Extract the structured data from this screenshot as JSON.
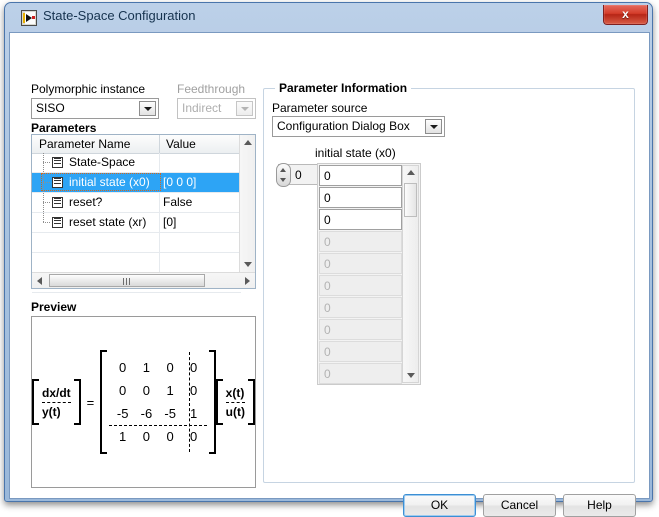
{
  "window": {
    "title": "State-Space Configuration",
    "icon": "labview-vi-icon",
    "close_label": "x"
  },
  "left_panel": {
    "polymorphic_label": "Polymorphic instance",
    "polymorphic_value": "SISO",
    "feedthrough_label": "Feedthrough",
    "feedthrough_value": "Indirect",
    "parameters_label": "Parameters",
    "table": {
      "columns": [
        "Parameter Name",
        "Value"
      ],
      "rows": [
        {
          "name": "State-Space",
          "value": "",
          "selected": false
        },
        {
          "name": "initial state (x0)",
          "value": "[0 0 0]",
          "selected": true
        },
        {
          "name": "reset?",
          "value": "False",
          "selected": false
        },
        {
          "name": "reset state (xr)",
          "value": "[0]",
          "selected": false
        }
      ]
    }
  },
  "preview": {
    "label": "Preview",
    "lhs_top": "dx/dt",
    "lhs_bottom": "y(t)",
    "equals": "=",
    "matrix": [
      [
        "0",
        "1",
        "0",
        "0"
      ],
      [
        "0",
        "0",
        "1",
        "0"
      ],
      [
        "-5",
        "-6",
        "-5",
        "1"
      ],
      [
        "1",
        "0",
        "0",
        "0"
      ]
    ],
    "rhs_top": "x(t)",
    "rhs_bottom": "u(t)"
  },
  "parameter_information": {
    "legend": "Parameter Information",
    "source_label": "Parameter source",
    "source_value": "Configuration Dialog Box",
    "array_label": "initial state (x0)",
    "array_index": "0",
    "array_cells": [
      {
        "value": "0",
        "active": true
      },
      {
        "value": "0",
        "active": true
      },
      {
        "value": "0",
        "active": true
      },
      {
        "value": "0",
        "active": false
      },
      {
        "value": "0",
        "active": false
      },
      {
        "value": "0",
        "active": false
      },
      {
        "value": "0",
        "active": false
      },
      {
        "value": "0",
        "active": false
      },
      {
        "value": "0",
        "active": false
      },
      {
        "value": "0",
        "active": false
      }
    ]
  },
  "buttons": {
    "ok": "OK",
    "cancel": "Cancel",
    "help": "Help"
  },
  "colors": {
    "titlebar_blue": "#aac4e0",
    "selection_blue": "#2da4f5",
    "close_red": "#d43c29",
    "focus_orange": "#d2691e",
    "group_border": "#c6d4e2"
  }
}
